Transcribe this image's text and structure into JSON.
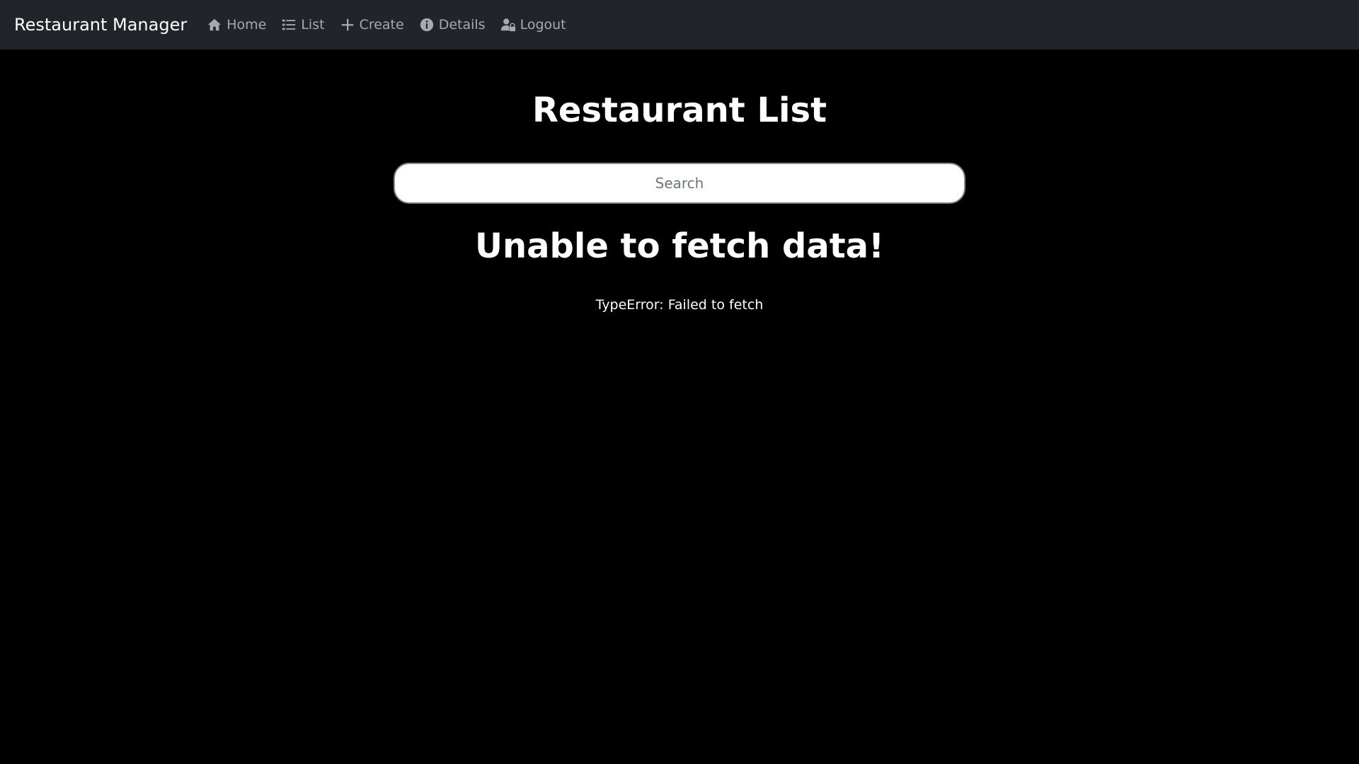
{
  "navbar": {
    "brand": "Restaurant Manager",
    "items": [
      {
        "label": "Home",
        "icon": "home-icon"
      },
      {
        "label": "List",
        "icon": "list-icon"
      },
      {
        "label": "Create",
        "icon": "plus-icon"
      },
      {
        "label": "Details",
        "icon": "info-icon"
      },
      {
        "label": "Logout",
        "icon": "user-lock-icon"
      }
    ]
  },
  "main": {
    "title": "Restaurant List",
    "search": {
      "placeholder": "Search",
      "value": ""
    },
    "error_heading": "Unable to fetch data!",
    "error_message": "TypeError: Failed to fetch"
  },
  "colors": {
    "navbar_bg": "#212529",
    "page_bg": "#000000",
    "nav_text": "#a6a9ad",
    "text": "#ffffff"
  }
}
